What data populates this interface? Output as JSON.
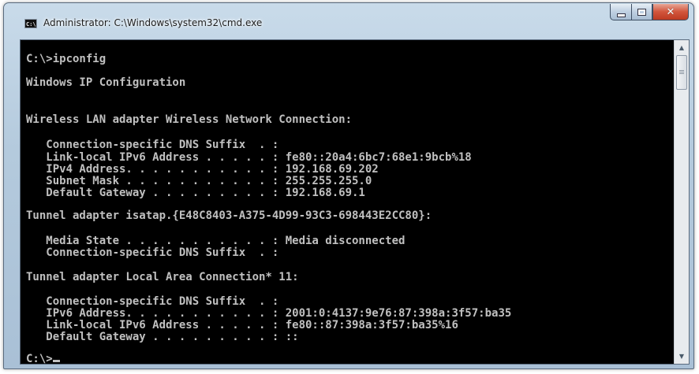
{
  "window": {
    "title": "Administrator: C:\\Windows\\system32\\cmd.exe",
    "icon_text": "C:\\"
  },
  "caption": {
    "minimize": "minimize",
    "maximize": "maximize",
    "close": "✕"
  },
  "console": {
    "lines": [
      "C:\\>ipconfig",
      "Windows IP Configuration",
      "Wireless LAN adapter Wireless Network Connection:",
      "   Connection-specific DNS Suffix  . :",
      "   Link-local IPv6 Address . . . . . : fe80::20a4:6bc7:68e1:9bcb%18",
      "   IPv4 Address. . . . . . . . . . . : 192.168.69.202",
      "   Subnet Mask . . . . . . . . . . . : 255.255.255.0",
      "   Default Gateway . . . . . . . . . : 192.168.69.1",
      "Tunnel adapter isatap.{E48C8403-A375-4D99-93C3-698443E2CC80}:",
      "   Media State . . . . . . . . . . . : Media disconnected",
      "   Connection-specific DNS Suffix  . :",
      "Tunnel adapter Local Area Connection* 11:",
      "   Connection-specific DNS Suffix  . :",
      "   IPv6 Address. . . . . . . . . . . : 2001:0:4137:9e76:87:398a:3f57:ba35",
      "   Link-local IPv6 Address . . . . . : fe80::87:398a:3f57:ba35%16",
      "   Default Gateway . . . . . . . . . : ::"
    ],
    "prompt": "C:\\>"
  },
  "colors": {
    "console_bg": "#000000",
    "console_text": "#c0c0c0",
    "close_button": "#c8432b"
  },
  "icons": [
    "cmd-icon",
    "minimize-icon",
    "maximize-icon",
    "close-icon",
    "scroll-up-icon",
    "scroll-down-icon"
  ]
}
